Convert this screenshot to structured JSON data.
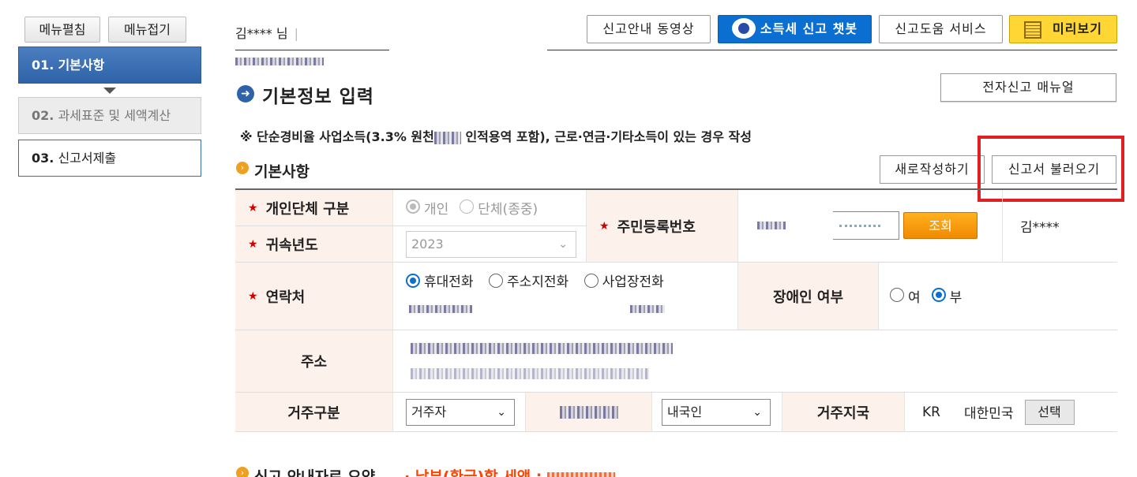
{
  "sidebar": {
    "expand_label": "메뉴펼침",
    "collapse_label": "메뉴접기",
    "steps": [
      {
        "num": "01.",
        "label": "기본사항"
      },
      {
        "num": "02.",
        "label": "과세표준 및 세액계산"
      },
      {
        "num": "03.",
        "label": "신고서제출"
      }
    ]
  },
  "header": {
    "user_name": "김****",
    "user_suffix": "님",
    "buttons": {
      "video": "신고안내 동영상",
      "chatbot": "소득세 신고 챗봇",
      "help": "신고도움 서비스",
      "preview": "미리보기"
    }
  },
  "page": {
    "title": "기본정보 입력",
    "manual_label": "전자신고 매뉴얼",
    "note_before": "※ 단순경비율 사업소득(3.3% 원천",
    "note_after": " 인적용역 포함), 근로·연금·기타소득이 있는 경우 작성"
  },
  "section": {
    "title": "기본사항",
    "new_label": "새로작성하기",
    "load_label": "신고서 불러오기"
  },
  "form": {
    "type_label": "개인단체 구분",
    "type_options": [
      "개인",
      "단체(종중)"
    ],
    "year_label": "귀속년도",
    "year_value": "2023",
    "rrn_label": "주민등록번호",
    "query_label": "조회",
    "rrn_name": "김****",
    "contact_label": "연락처",
    "contact_options": [
      "휴대전화",
      "주소지전화",
      "사업장전화"
    ],
    "disabled_label": "장애인 여부",
    "disabled_options": [
      "여",
      "부"
    ],
    "address_label": "주소",
    "residence_label": "거주구분",
    "residence_value": "거주자",
    "nationality_value": "내국인",
    "country_label": "거주지국",
    "country_code": "KR",
    "country_name": "대한민국",
    "choose_label": "선택"
  },
  "bottom": {
    "section_title": "신고 안내자료 요약",
    "note": "· 납부(환급)할 세액 : "
  },
  "colors": {
    "step_active": "#2f63a8",
    "chatbot_btn": "#0a6fd1",
    "preview_btn": "#ffd633",
    "highlight_box": "#e02020",
    "query_btn": "#f08a00"
  }
}
